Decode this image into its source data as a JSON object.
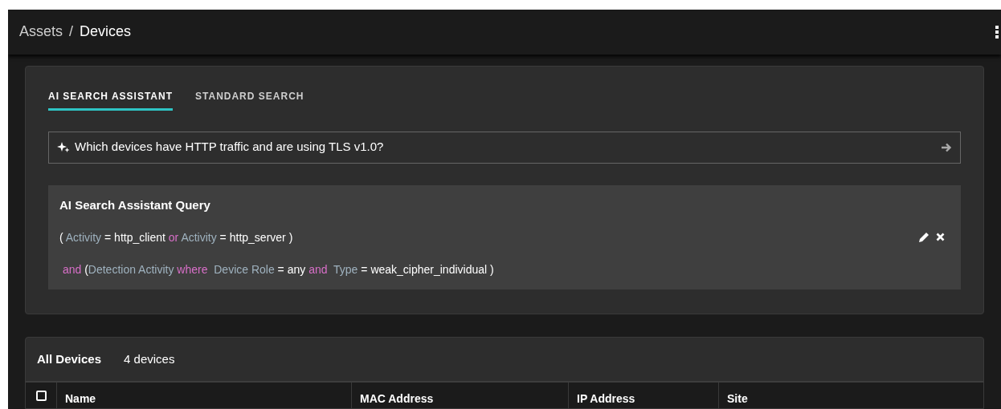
{
  "breadcrumb": [
    {
      "label": "Assets",
      "current": false
    },
    {
      "label": "Devices",
      "current": true
    }
  ],
  "breadcrumb_separator": "/",
  "search_tabs": [
    {
      "label": "AI SEARCH ASSISTANT",
      "selected": true
    },
    {
      "label": "STANDARD SEARCH",
      "selected": false
    }
  ],
  "ai_search": {
    "value": "Which devices have HTTP traffic and are using TLS v1.0?"
  },
  "query": {
    "title": "AI Search Assistant Query",
    "lines": [
      [
        {
          "kind": "plain",
          "text": "( "
        },
        {
          "kind": "field",
          "text": "Activity"
        },
        {
          "kind": "plain",
          "text": " = "
        },
        {
          "kind": "value",
          "text": "http_client"
        },
        {
          "kind": "operator",
          "text": " or "
        },
        {
          "kind": "field",
          "text": "Activity"
        },
        {
          "kind": "plain",
          "text": " = "
        },
        {
          "kind": "value",
          "text": "http_server"
        },
        {
          "kind": "plain",
          "text": " )"
        }
      ],
      [
        {
          "kind": "operator",
          "text": " and "
        },
        {
          "kind": "plain",
          "text": "("
        },
        {
          "kind": "field",
          "text": "Detection Activity"
        },
        {
          "kind": "operator",
          "text": " where "
        },
        {
          "kind": "field",
          "text": " Device Role"
        },
        {
          "kind": "plain",
          "text": " = "
        },
        {
          "kind": "value",
          "text": "any"
        },
        {
          "kind": "operator",
          "text": " and "
        },
        {
          "kind": "field",
          "text": " Type"
        },
        {
          "kind": "plain",
          "text": " = "
        },
        {
          "kind": "value",
          "text": "weak_cipher_individual"
        },
        {
          "kind": "plain",
          "text": " )"
        }
      ]
    ]
  },
  "devices": {
    "title": "All Devices",
    "count": "4 devices",
    "select_all_checked": false,
    "columns": [
      "Name",
      "MAC Address",
      "IP Address",
      "Site"
    ]
  }
}
